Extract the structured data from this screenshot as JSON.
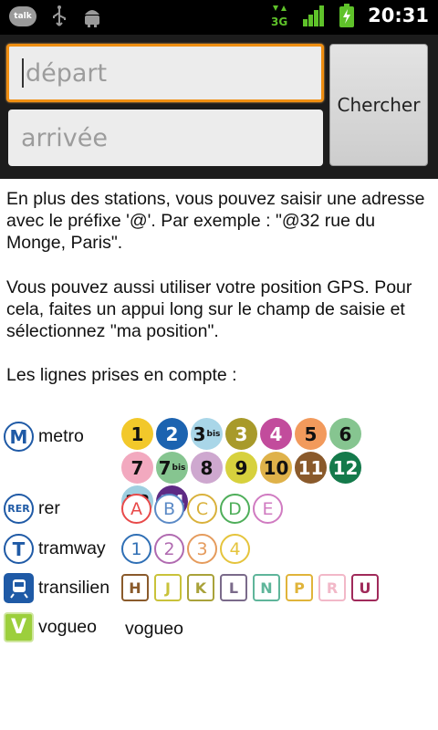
{
  "status_bar": {
    "time": "20:31",
    "talk_label": "talk",
    "network_label": "3G"
  },
  "search": {
    "depart_placeholder": "départ",
    "arrivee_placeholder": "arrivée",
    "search_label": "Chercher"
  },
  "help": {
    "p1": "En plus des stations, vous pouvez saisir une adresse avec le préfixe '@'. Par exemple : \"@32 rue du Monge, Paris\".",
    "p2": "Vous pouvez aussi utiliser votre position GPS. Pour cela, faites un appui long sur le champ de saisie et sélectionnez \"ma position\".",
    "p3": "Les lignes prises en compte :"
  },
  "modes": {
    "metro": {
      "icon_text": "M",
      "label": "metro"
    },
    "rer": {
      "icon_text": "RER",
      "label": "rer"
    },
    "tramway": {
      "icon_text": "T",
      "label": "tramway"
    },
    "transilien": {
      "label": "transilien"
    },
    "vogueo": {
      "icon_text": "V",
      "label": "vogueo",
      "line_text": "vogueo"
    }
  },
  "metro_lines": [
    {
      "num": "1",
      "sup": "",
      "color": "#f2c82a",
      "light": false
    },
    {
      "num": "2",
      "sup": "",
      "color": "#1c63b0",
      "light": true
    },
    {
      "num": "3",
      "sup": "bis",
      "color": "#a9d6e8",
      "light": false
    },
    {
      "num": "3",
      "sup": "",
      "color": "#a89a2a",
      "light": true
    },
    {
      "num": "4",
      "sup": "",
      "color": "#c24c9c",
      "light": true
    },
    {
      "num": "5",
      "sup": "",
      "color": "#f29a5c",
      "light": false
    },
    {
      "num": "6",
      "sup": "",
      "color": "#86c590",
      "light": false
    },
    {
      "num": "7",
      "sup": "",
      "color": "#f2a9bf",
      "light": false
    },
    {
      "num": "7",
      "sup": "bis",
      "color": "#86c590",
      "light": false
    },
    {
      "num": "8",
      "sup": "",
      "color": "#cea8cf",
      "light": false
    },
    {
      "num": "9",
      "sup": "",
      "color": "#d7d13d",
      "light": false
    },
    {
      "num": "10",
      "sup": "",
      "color": "#dfb24a",
      "light": false
    },
    {
      "num": "11",
      "sup": "",
      "color": "#8a5a2b",
      "light": true
    },
    {
      "num": "12",
      "sup": "",
      "color": "#147a4b",
      "light": true
    },
    {
      "num": "13",
      "sup": "",
      "color": "#9fcfe0",
      "light": false
    },
    {
      "num": "14",
      "sup": "",
      "color": "#5e2a84",
      "light": true
    }
  ],
  "rer_lines": [
    {
      "letter": "A",
      "color": "#e84a4a"
    },
    {
      "letter": "B",
      "color": "#5b8ac6"
    },
    {
      "letter": "C",
      "color": "#d9b13b"
    },
    {
      "letter": "D",
      "color": "#4fae5a"
    },
    {
      "letter": "E",
      "color": "#d07bc1"
    }
  ],
  "tram_lines": [
    {
      "num": "1",
      "color": "#2f6fb5"
    },
    {
      "num": "2",
      "color": "#b06ab0"
    },
    {
      "num": "3",
      "color": "#e59b5c"
    },
    {
      "num": "4",
      "color": "#e5c43c"
    }
  ],
  "transilien_lines": [
    {
      "letter": "H",
      "color": "#8a5a2b"
    },
    {
      "letter": "J",
      "color": "#c9c23a"
    },
    {
      "letter": "K",
      "color": "#a9a23a"
    },
    {
      "letter": "L",
      "color": "#7a6a8a"
    },
    {
      "letter": "N",
      "color": "#5fb59a"
    },
    {
      "letter": "P",
      "color": "#e0b43a"
    },
    {
      "letter": "R",
      "color": "#f2b8c8"
    },
    {
      "letter": "U",
      "color": "#a02a5a"
    }
  ]
}
